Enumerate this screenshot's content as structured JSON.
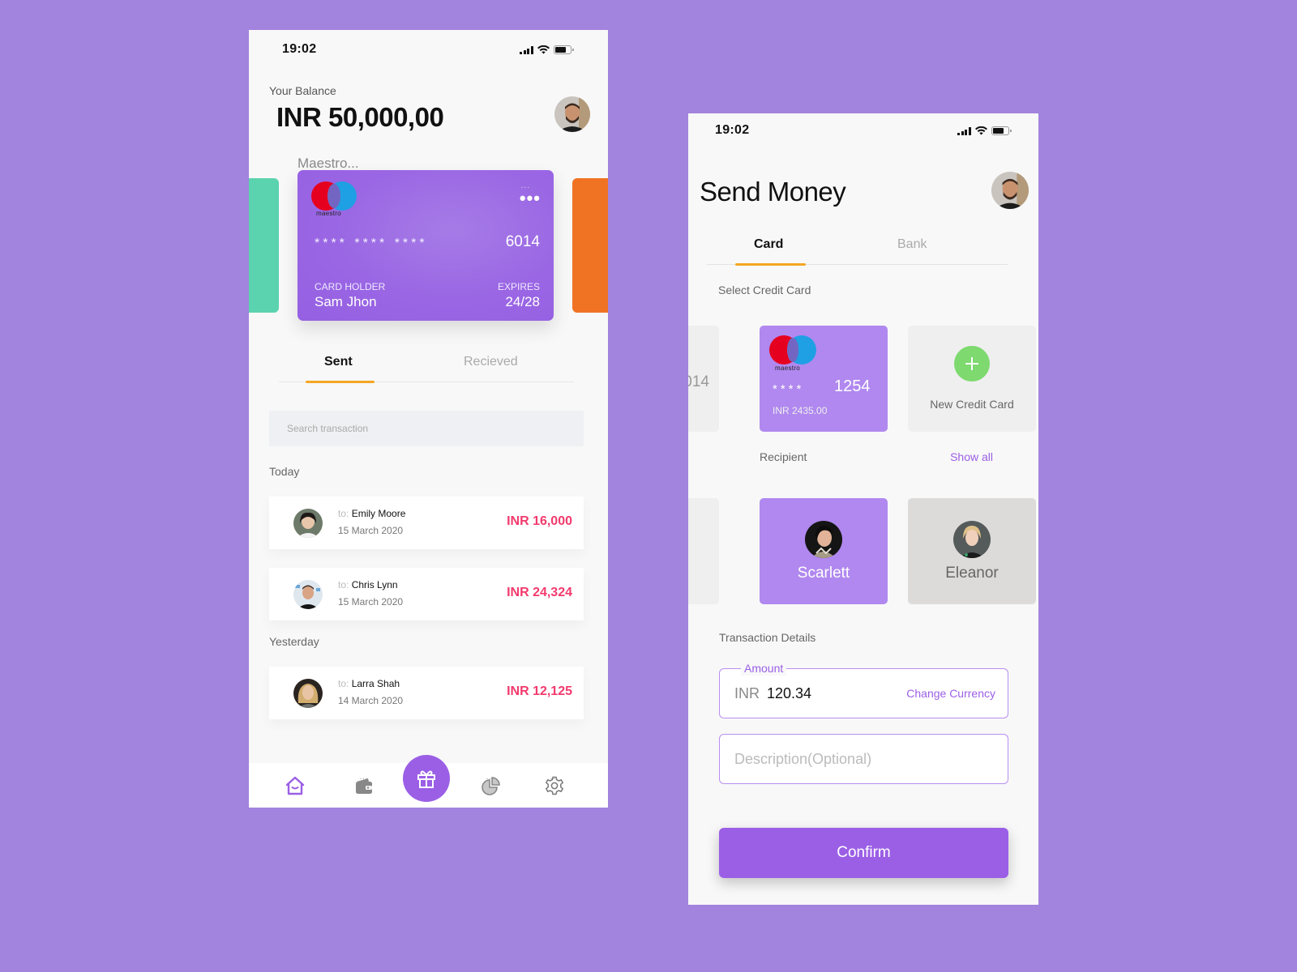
{
  "screen1": {
    "status": {
      "time": "19:02"
    },
    "balance": {
      "label": "Your Balance",
      "value": "INR 50,000,00"
    },
    "card_name": "Maestro...",
    "card": {
      "brand": "maestro",
      "masked": "**** **** ****",
      "last4": "6014",
      "menu_small": "...",
      "menu": "•••",
      "holder_label": "CARD HOLDER",
      "holder": "Sam Jhon",
      "expires_label": "EXPIRES",
      "expires": "24/28"
    },
    "tabs": [
      {
        "label": "Sent",
        "active": true
      },
      {
        "label": "Recieved",
        "active": false
      }
    ],
    "search": {
      "placeholder": "Search transaction",
      "value": ""
    },
    "groups": [
      {
        "label": "Today",
        "transactions": [
          {
            "prefix": "to:",
            "name": "Emily Moore",
            "date": "15 March 2020",
            "amount": "INR 16,000"
          },
          {
            "prefix": "to:",
            "name": "Chris Lynn",
            "date": "15 March 2020",
            "amount": "INR 24,324"
          }
        ]
      },
      {
        "label": "Yesterday",
        "transactions": [
          {
            "prefix": "to:",
            "name": "Larra Shah",
            "date": "14 March 2020",
            "amount": "INR 12,125"
          }
        ]
      }
    ],
    "nav": {
      "items": [
        "home-icon",
        "wallet-icon",
        "gift-icon",
        "pie-chart-icon",
        "settings-icon"
      ],
      "dots": "...",
      "active": "home-icon"
    }
  },
  "screen2": {
    "status": {
      "time": "19:02"
    },
    "title": "Send Money",
    "tabs": [
      {
        "label": "Card",
        "active": true
      },
      {
        "label": "Bank",
        "active": false
      }
    ],
    "select_card_label": "Select Credit Card",
    "cards": [
      {
        "partial_text": "014",
        "selected": false
      },
      {
        "brand": "maestro",
        "masked": "****",
        "last4": "1254",
        "balance": "INR 2435.00",
        "selected": true
      },
      {
        "new_label": "New Credit Card"
      }
    ],
    "recipient_label": "Recipient",
    "show_all": "Show all",
    "recipients": [
      {
        "name": "",
        "selected": false
      },
      {
        "name": "Scarlett",
        "selected": true
      },
      {
        "name": "Eleanor",
        "selected": false
      }
    ],
    "transaction_label": "Transaction Details",
    "amount": {
      "legend": "Amount",
      "currency": "INR",
      "value": "120.34",
      "change_currency": "Change Currency"
    },
    "description": {
      "placeholder": "Description(Optional)",
      "value": ""
    },
    "confirm": "Confirm"
  },
  "colors": {
    "background": "#a283de",
    "accent": "#9b5fe6",
    "tab_underline": "#f5a623",
    "amount_red": "#f23a6d",
    "card_green": "#5bd3ae",
    "card_orange": "#f07324",
    "add_green": "#7ed96f"
  }
}
